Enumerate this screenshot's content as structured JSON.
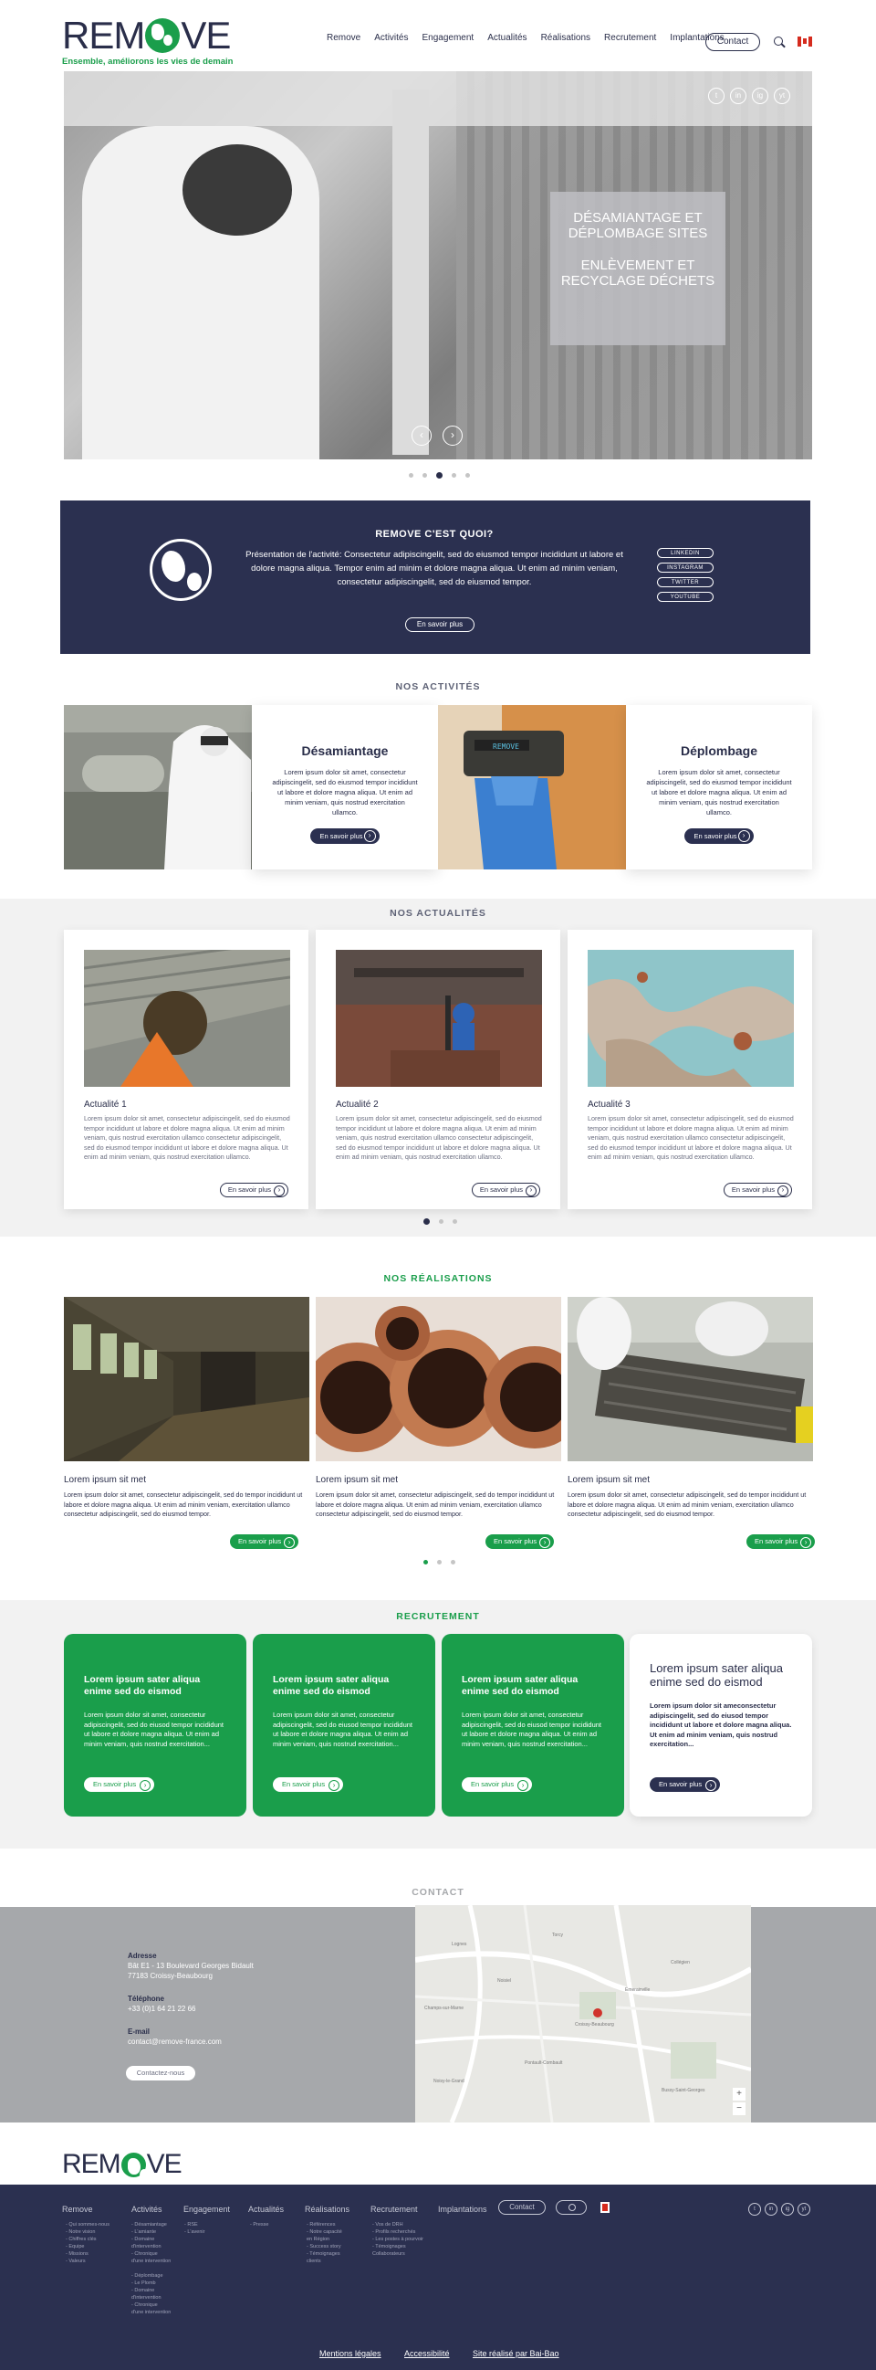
{
  "header": {
    "logo_text_pre": "REM",
    "logo_text_post": "VE",
    "tagline": "Ensemble, améliorons les vies de demain",
    "nav": [
      "Remove",
      "Activités",
      "Engagement",
      "Actualités",
      "Réalisations",
      "Recrutement",
      "Implantations"
    ],
    "contact_label": "Contact"
  },
  "hero": {
    "caption_line1": "DÉSAMIANTAGE ET DÉPLOMBAGE SITES",
    "caption_line2": "ENLÈVEMENT ET RECYCLAGE DÉCHETS",
    "social": [
      "t",
      "in",
      "ig",
      "yt"
    ],
    "prev": "‹",
    "next": "›"
  },
  "about": {
    "title": "REMOVE C'EST QUOI?",
    "text": "Présentation de l'activité: Consectetur adipiscingelit, sed do eiusmod tempor incididunt ut labore et dolore magna aliqua. Tempor enim ad minim et dolore magna aliqua. Ut enim ad minim veniam, consectetur adipiscingelit, sed do eiusmod tempor.",
    "button": "En savoir plus",
    "links": [
      "LINKEDIN",
      "INSTAGRAM",
      "TWITTER",
      "YOUTUBE"
    ]
  },
  "activities": {
    "title": "NOS ACTIVITÉS",
    "items": [
      {
        "name": "Désamiantage",
        "text": "Lorem ipsum dolor sit amet, consectetur adipiscingelit, sed do eiusmod tempor incididunt ut labore et dolore magna aliqua. Ut enim ad minim veniam, quis nostrud exercitation ullamco.",
        "button": "En savoir plus"
      },
      {
        "name": "Déplombage",
        "text": "Lorem ipsum dolor sit amet, consectetur adipiscingelit, sed do eiusmod tempor incididunt ut labore et dolore magna aliqua. Ut enim ad minim veniam, quis nostrud exercitation ullamco.",
        "button": "En savoir plus"
      }
    ],
    "device_label": "REMOVE"
  },
  "news": {
    "title": "NOS ACTUALITÉS",
    "items": [
      {
        "name": "Actualité 1",
        "text": "Lorem ipsum dolor sit amet, consectetur adipiscingelit, sed do eiusmod tempor incididunt ut labore et dolore magna aliqua. Ut enim ad minim veniam, quis nostrud exercitation ullamco consectetur adipiscingelit, sed do eiusmod tempor incididunt ut labore et dolore magna aliqua. Ut enim ad minim veniam, quis nostrud exercitation ullamco.",
        "button": "En savoir plus"
      },
      {
        "name": "Actualité 2",
        "text": "Lorem ipsum dolor sit amet, consectetur adipiscingelit, sed do eiusmod tempor incididunt ut labore et dolore magna aliqua. Ut enim ad minim veniam, quis nostrud exercitation ullamco consectetur adipiscingelit, sed do eiusmod tempor incididunt ut labore et dolore magna aliqua. Ut enim ad minim veniam, quis nostrud exercitation ullamco.",
        "button": "En savoir plus"
      },
      {
        "name": "Actualité 3",
        "text": "Lorem ipsum dolor sit amet, consectetur adipiscingelit, sed do eiusmod tempor incididunt ut labore et dolore magna aliqua. Ut enim ad minim veniam, quis nostrud exercitation ullamco consectetur adipiscingelit, sed do eiusmod tempor incididunt ut labore et dolore magna aliqua. Ut enim ad minim veniam, quis nostrud exercitation ullamco.",
        "button": "En savoir plus"
      }
    ]
  },
  "realizations": {
    "title": "NOS RÉALISATIONS",
    "items": [
      {
        "name": "Lorem ipsum sit met",
        "text": "Lorem ipsum dolor sit amet, consectetur adipiscingelit, sed do tempor incididunt ut labore et dolore magna aliqua. Ut enim ad minim veniam, exercitation ullamco consectetur adipiscingelit, sed do eiusmod tempor.",
        "button": "En savoir plus"
      },
      {
        "name": "Lorem ipsum sit met",
        "text": "Lorem ipsum dolor sit amet, consectetur adipiscingelit, sed do tempor incididunt ut labore et dolore magna aliqua. Ut enim ad minim veniam, exercitation ullamco consectetur adipiscingelit, sed do eiusmod tempor.",
        "button": "En savoir plus"
      },
      {
        "name": "Lorem ipsum sit met",
        "text": "Lorem ipsum dolor sit amet, consectetur adipiscingelit, sed do tempor incididunt ut labore et dolore magna aliqua. Ut enim ad minim veniam, exercitation ullamco consectetur adipiscingelit, sed do eiusmod tempor.",
        "button": "En savoir plus"
      }
    ]
  },
  "recruitment": {
    "title": "RECRUTEMENT",
    "items": [
      {
        "title": "Lorem ipsum sater aliqua enime sed do eismod",
        "text": "Lorem ipsum dolor sit amet, consectetur adipiscingelit, sed do eiusod tempor incididunt ut labore et dolore magna aliqua. Ut enim ad minim veniam, quis nostrud exercitation...",
        "button": "En savoir plus"
      },
      {
        "title": "Lorem ipsum sater aliqua enime sed do eismod",
        "text": "Lorem ipsum dolor sit amet, consectetur adipiscingelit, sed do eiusod tempor incididunt ut labore et dolore magna aliqua. Ut enim ad minim veniam, quis nostrud exercitation...",
        "button": "En savoir plus"
      },
      {
        "title": "Lorem ipsum sater aliqua enime sed do eismod",
        "text": "Lorem ipsum dolor sit amet, consectetur adipiscingelit, sed do eiusod tempor incididunt ut labore et dolore magna aliqua. Ut enim ad minim veniam, quis nostrud exercitation...",
        "button": "En savoir plus"
      },
      {
        "title": "Lorem ipsum sater aliqua enime sed do eismod",
        "text": "Lorem ipsum dolor sit ameconsectetur adipiscingelit, sed do eiusod tempor incididunt ut labore et dolore magna aliqua. Ut enim ad minim veniam, quis nostrud exercitation...",
        "button": "En savoir plus"
      }
    ]
  },
  "contact": {
    "title": "CONTACT",
    "address_label": "Adresse",
    "address_line1": "Bât E1 - 13 Boulevard Georges Bidault",
    "address_line2": "77183 Croissy-Beaubourg",
    "phone_label": "Téléphone",
    "phone": "+33 (0)1 64 21 22 66",
    "email_label": "E-mail",
    "email": "contact@remove-france.com",
    "button": "Contactez-nous",
    "map_labels": [
      "Lognes",
      "Torcy",
      "Noisiel",
      "Champs-sur-Marne",
      "Croissy-Beaubourg",
      "Émerainville",
      "Pontault-Combault",
      "Noisy-le-Grand",
      "Collégien",
      "Bussy-Saint-Georges"
    ],
    "map_zoom_in": "+",
    "map_zoom_out": "−"
  },
  "footer": {
    "logo_text_pre": "REM",
    "logo_text_post": "VE",
    "nav": [
      "Remove",
      "Activités",
      "Engagement",
      "Actualités",
      "Réalisations",
      "Recrutement",
      "Implantations"
    ],
    "lists": [
      [
        "- Qui sommes-nous",
        "- Notre vision",
        "- Chiffres clés",
        "- Equipe",
        "- Missions",
        "- Valeurs"
      ],
      [
        "- Désamiantage",
        "  - L'amiante",
        "  - Domaine",
        "    d'intervention",
        "  - Chronique",
        "    d'une intervention",
        "",
        "- Déplombage",
        "  - Le Plomb",
        "  - Domaine",
        "    d'intervention",
        "  - Chronique",
        "    d'une intervention"
      ],
      [
        "- RSE",
        "- L'avenir"
      ],
      [
        "- Presse"
      ],
      [
        "- Références",
        "- Notre capacité",
        "  en Région",
        "- Success story",
        "- Témoignages",
        "  clients"
      ],
      [
        "- Vos de DRH",
        "- Profils recherchés",
        "- Les postes à pourvoir",
        "- Témoignages",
        "  Collaborateurs"
      ]
    ],
    "contact_label": "Contact",
    "social": [
      "t",
      "in",
      "ig",
      "yt"
    ],
    "legal": [
      "Mentions légales",
      "Accessibilité",
      "Site réalisé par Bai-Bao"
    ]
  }
}
